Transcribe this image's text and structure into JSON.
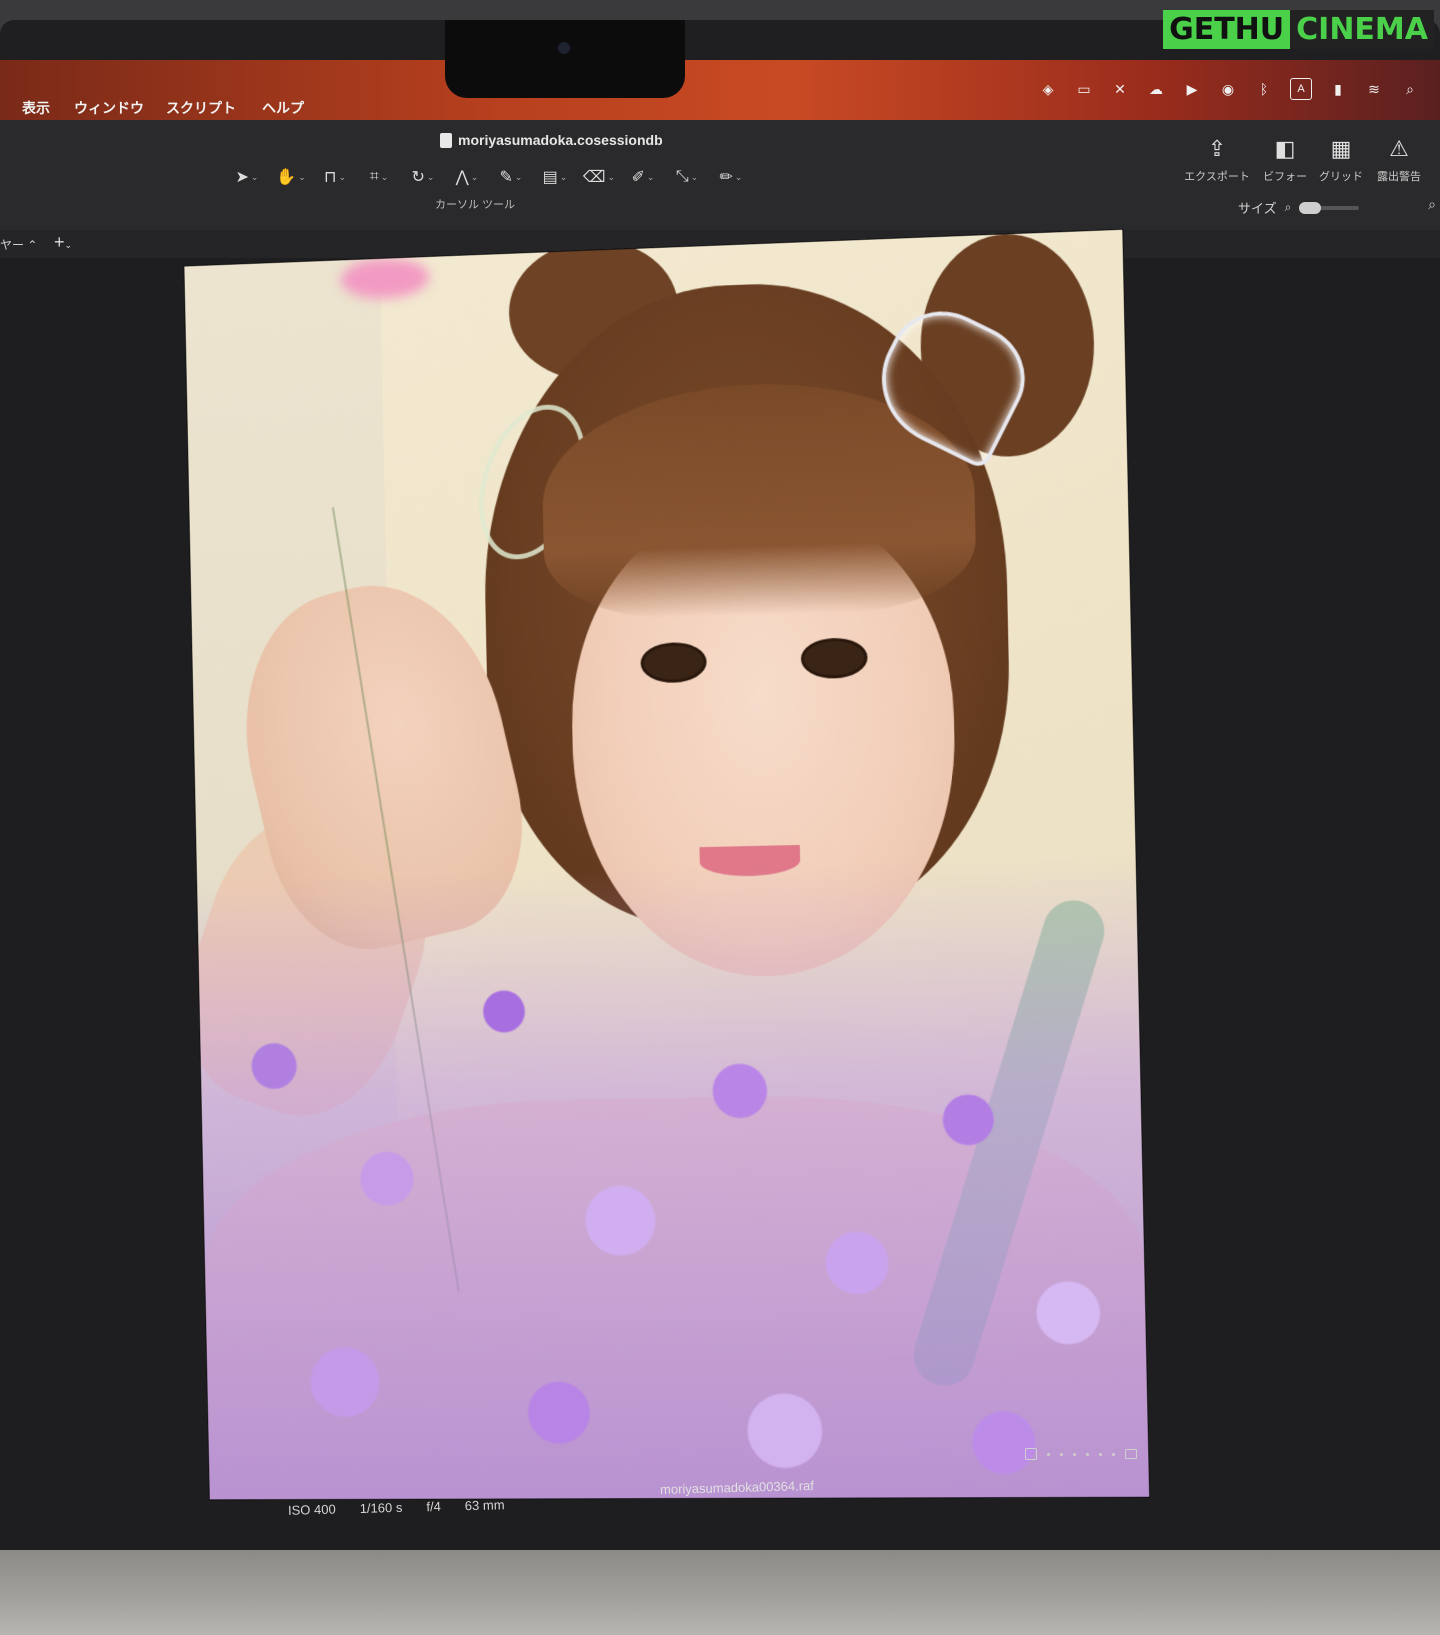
{
  "watermark": {
    "left": "GETHU",
    "right": "CINEMA"
  },
  "menubar": {
    "items": [
      "表示",
      "ウィンドウ",
      "スクリプト",
      "ヘルプ"
    ],
    "status_icons": [
      "dropbox-icon",
      "display-icon",
      "butterfly-icon",
      "cloud-icon",
      "play-icon",
      "airdrop-icon",
      "bluetooth-icon",
      "input-source-icon",
      "battery-icon",
      "wifi-icon",
      "spotlight-search-icon"
    ],
    "input_source_label": "A"
  },
  "toolbar": {
    "document_title": "moriyasumadoka.cosessiondb",
    "tools": [
      "cursor",
      "hand",
      "straighten",
      "crop",
      "rotate",
      "keystone",
      "brush",
      "gradient",
      "radial",
      "color-picker",
      "white-balance-picker",
      "annotate"
    ],
    "tool_label": "カーソル ツール",
    "right_tools": [
      {
        "name": "export",
        "label": "エクスポート"
      },
      {
        "name": "before-after",
        "label": "ビフォー"
      },
      {
        "name": "grid",
        "label": "グリッド"
      },
      {
        "name": "exposure-warning",
        "label": "露出警告"
      }
    ],
    "size_label": "サイズ"
  },
  "subbar": {
    "layer_select": "ヤー",
    "add_label": "+"
  },
  "photo": {
    "filename": "moriyasumadoka00364.raf",
    "exif": {
      "iso": "ISO 400",
      "shutter": "1/160 s",
      "aperture": "f/4",
      "focal": "63 mm"
    }
  }
}
